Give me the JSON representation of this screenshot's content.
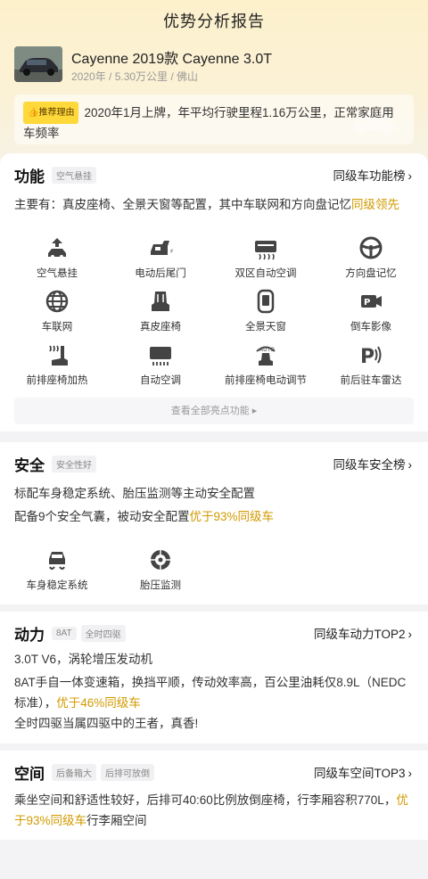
{
  "header": {
    "title": "优势分析报告"
  },
  "car": {
    "name": "Cayenne 2019款 Cayenne 3.0T",
    "meta": "2020年 / 5.30万公里 / 佛山"
  },
  "reason": {
    "tag": "推荐理由",
    "text": "2020年1月上牌，年平均行驶里程1.16万公里，正常家庭用车频率"
  },
  "function_section": {
    "title": "功能",
    "tag": "空气悬挂",
    "link": "同级车功能榜",
    "summary_prefix": "主要有：真皮座椅、全景天窗等配置，其中车联网和方向盘记忆",
    "summary_highlight": "同级领先",
    "features": [
      {
        "label": "空气悬挂",
        "icon": "air-suspension-icon"
      },
      {
        "label": "电动后尾门",
        "icon": "power-tailgate-icon"
      },
      {
        "label": "双区自动空调",
        "icon": "dual-zone-ac-icon"
      },
      {
        "label": "方向盘记忆",
        "icon": "steering-memory-icon"
      },
      {
        "label": "车联网",
        "icon": "connected-car-icon"
      },
      {
        "label": "真皮座椅",
        "icon": "leather-seat-icon"
      },
      {
        "label": "全景天窗",
        "icon": "panoramic-sunroof-icon"
      },
      {
        "label": "倒车影像",
        "icon": "reverse-camera-icon"
      },
      {
        "label": "前排座椅加热",
        "icon": "seat-heating-icon"
      },
      {
        "label": "自动空调",
        "icon": "auto-ac-icon"
      },
      {
        "label": "前排座椅电动调节",
        "icon": "power-seat-icon"
      },
      {
        "label": "前后驻车雷达",
        "icon": "parking-radar-icon"
      }
    ],
    "more_label": "查看全部亮点功能"
  },
  "safety_section": {
    "title": "安全",
    "tag": "安全性好",
    "link": "同级车安全榜",
    "line1": "标配车身稳定系统、胎压监测等主动安全配置",
    "line2_prefix": "配备9个安全气囊，被动安全配置",
    "line2_highlight": "优于93%同级车",
    "features": [
      {
        "label": "车身稳定系统",
        "icon": "stability-control-icon"
      },
      {
        "label": "胎压监测",
        "icon": "tire-pressure-icon"
      }
    ]
  },
  "power_section": {
    "title": "动力",
    "tag1": "8AT",
    "tag2": "全时四驱",
    "link": "同级车动力TOP2",
    "line1": "3.0T V6，涡轮增压发动机",
    "line2_prefix": "8AT手自一体变速箱，换挡平顺，传动效率高，百公里油耗仅8.9L（NEDC标准），",
    "line2_highlight": "优于46%同级车",
    "line3": "全时四驱当属四驱中的王者，真香!"
  },
  "space_section": {
    "title": "空间",
    "tag1": "后备箱大",
    "tag2": "后排可放倒",
    "link": "同级车空间TOP3",
    "text_prefix": "乘坐空间和舒适性较好，后排可40:60比例放倒座椅，行李厢容积770L，",
    "text_highlight": "优于93%同级车",
    "text_suffix": "行李厢空间"
  },
  "colors": {
    "accent": "#d19a00",
    "tag_bg": "#ffd83a",
    "hero_top": "#fdf1cc"
  }
}
